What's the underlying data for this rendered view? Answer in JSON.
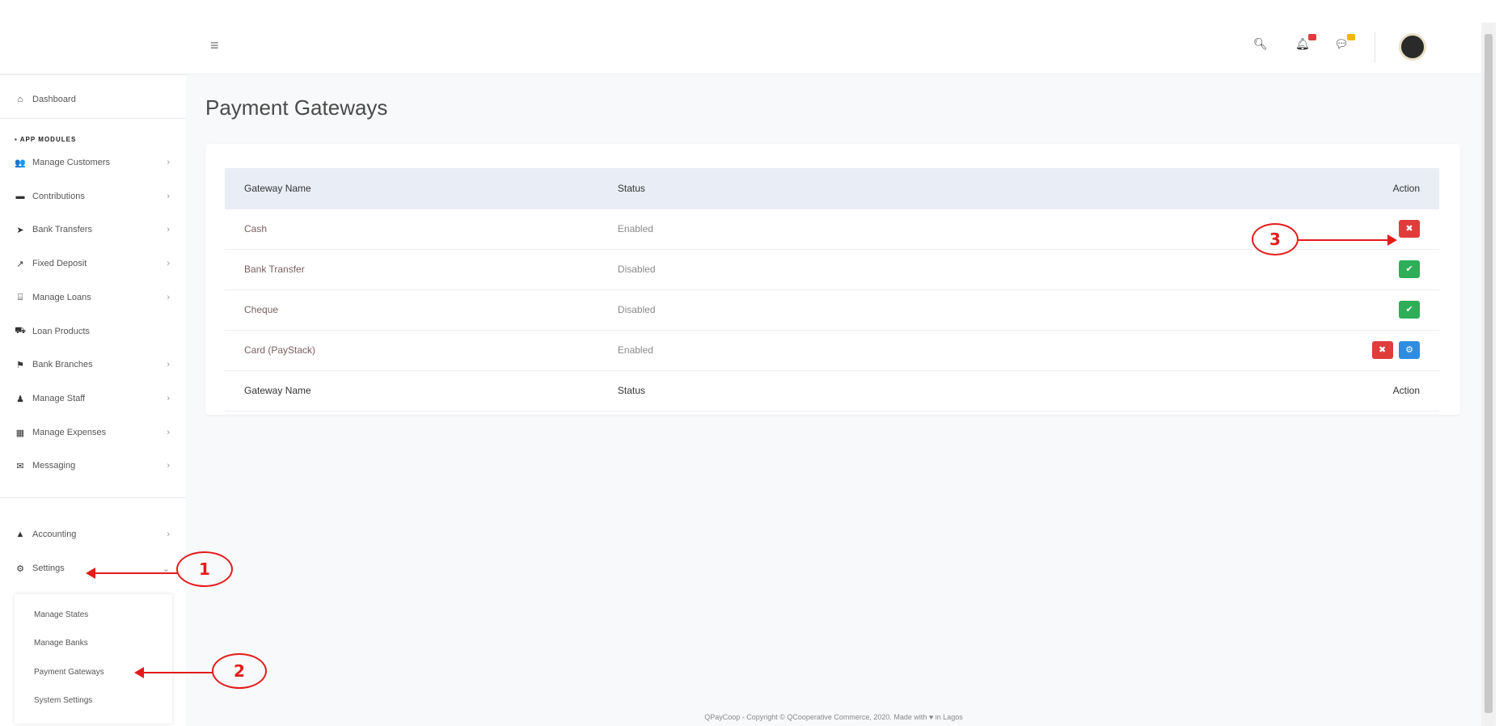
{
  "sidebar": {
    "dashboard": "Dashboard",
    "section_title": "APP MODULES",
    "items": [
      {
        "label": "Manage Customers",
        "icon": "users-icon"
      },
      {
        "label": "Contributions",
        "icon": "money-icon"
      },
      {
        "label": "Bank Transfers",
        "icon": "send-icon"
      },
      {
        "label": "Fixed Deposit",
        "icon": "chart-icon"
      },
      {
        "label": "Manage Loans",
        "icon": "bank-icon"
      },
      {
        "label": "Loan Products",
        "icon": "cart-icon"
      },
      {
        "label": "Bank Branches",
        "icon": "flag-icon"
      },
      {
        "label": "Manage Staff",
        "icon": "user-icon"
      },
      {
        "label": "Manage Expenses",
        "icon": "calculator-icon"
      },
      {
        "label": "Messaging",
        "icon": "comments-icon"
      }
    ],
    "accounting": "Accounting",
    "settings": "Settings",
    "settings_submenu": [
      "Manage States",
      "Manage Banks",
      "Payment Gateways",
      "System Settings"
    ]
  },
  "header": {
    "search_icon": "search-icon",
    "notification_color": "#e03c3c",
    "messages_color": "#f5b400"
  },
  "page": {
    "title": "Payment Gateways"
  },
  "table": {
    "headers": {
      "name": "Gateway Name",
      "status": "Status",
      "action": "Action"
    },
    "rows": [
      {
        "name": "Cash",
        "status": "Enabled"
      },
      {
        "name": "Bank Transfer",
        "status": "Disabled"
      },
      {
        "name": "Cheque",
        "status": "Disabled"
      },
      {
        "name": "Card (PayStack)",
        "status": "Enabled"
      }
    ]
  },
  "footer": {
    "text": "QPayCoop - Copyright © QCooperative Commerce, 2020. Made with ♥ in Lagos"
  },
  "annotations": [
    "1",
    "2",
    "3"
  ],
  "colors": {
    "danger": "#e03c3c",
    "success": "#2eae58",
    "info": "#2e8de0",
    "annotation": "#e41b1b"
  }
}
